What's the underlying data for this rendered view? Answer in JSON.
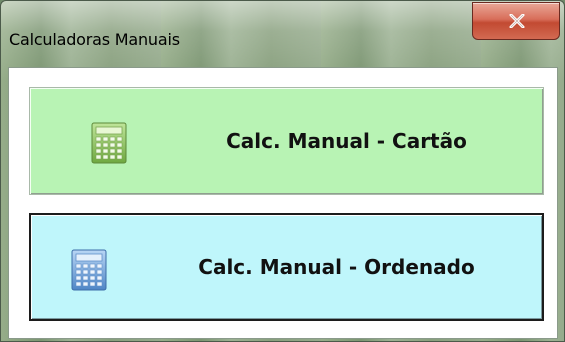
{
  "window": {
    "title": "Calculadoras Manuais",
    "close_symbol": "x"
  },
  "buttons": [
    {
      "label": "Calc. Manual - Cartão",
      "icon": "calculator-icon",
      "color": "#b8f3b4"
    },
    {
      "label": "Calc. Manual - Ordenado",
      "icon": "calculator-icon",
      "color": "#bff6fb"
    }
  ],
  "colors": {
    "close_button": "#c24a32",
    "cartao_button": "#b8f3b4",
    "ordenado_button": "#bff6fb"
  }
}
